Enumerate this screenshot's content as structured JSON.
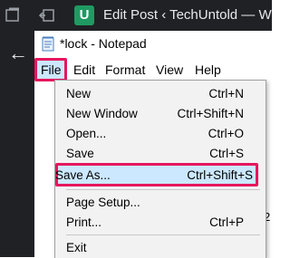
{
  "browser": {
    "tab_title": "Edit Post ‹ TechUntold — W",
    "tab_icon_letter": "U"
  },
  "window": {
    "title": "*lock - Notepad"
  },
  "menubar": {
    "file": "File",
    "edit": "Edit",
    "format": "Format",
    "view": "View",
    "help": "Help"
  },
  "file_menu": {
    "items": [
      {
        "label": "New",
        "shortcut": "Ctrl+N"
      },
      {
        "label": "New Window",
        "shortcut": "Ctrl+Shift+N"
      },
      {
        "label": "Open...",
        "shortcut": "Ctrl+O"
      },
      {
        "label": "Save",
        "shortcut": "Ctrl+S"
      },
      {
        "label": "Save As...",
        "shortcut": "Ctrl+Shift+S"
      },
      {
        "label": "Page Setup...",
        "shortcut": ""
      },
      {
        "label": "Print...",
        "shortcut": "Ctrl+P"
      },
      {
        "label": "Exit",
        "shortcut": ""
      }
    ]
  },
  "editor": {
    "visible_fragment": "2"
  },
  "colors": {
    "highlight_border": "#e6175e",
    "highlight_fill": "#cce8ff",
    "menu_bg": "#f2f2f2",
    "chrome_dark": "#202124"
  }
}
